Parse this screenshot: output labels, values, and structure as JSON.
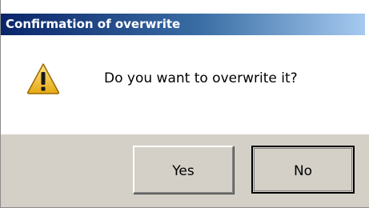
{
  "dialog": {
    "title": "Confirmation of overwrite",
    "message": "Do you want to overwrite it?",
    "icon": "warning-icon",
    "buttons": {
      "yes_label": "Yes",
      "no_label": "No"
    }
  },
  "colors": {
    "title_start": "#0a246a",
    "title_end": "#a6caf0",
    "button_face": "#d4d0c8",
    "warning_fill": "#f2c230"
  }
}
